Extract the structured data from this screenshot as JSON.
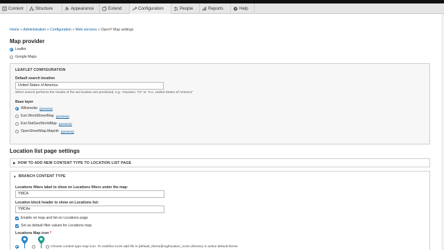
{
  "toolbar": {
    "items": [
      {
        "label": "Content",
        "icon": "content-icon"
      },
      {
        "label": "Structure",
        "icon": "structure-icon"
      },
      {
        "label": "Appearance",
        "icon": "appearance-icon"
      },
      {
        "label": "Extend",
        "icon": "extend-icon"
      },
      {
        "label": "Configuration",
        "icon": "wrench-icon"
      },
      {
        "label": "People",
        "icon": "people-icon"
      },
      {
        "label": "Reports",
        "icon": "reports-icon"
      },
      {
        "label": "Help",
        "icon": "help-icon"
      }
    ]
  },
  "breadcrumb": {
    "home": "Home",
    "administration": "Administration",
    "configuration": "Configuration",
    "web_services": "Web services",
    "current": "OpenY Map settings",
    "separator": "»"
  },
  "map_provider": {
    "title": "Map provider",
    "leaflet": "Leaflet",
    "google": "Google Maps",
    "selected": "Leaflet"
  },
  "leaflet_config": {
    "legend": "LEAFLET CONFIGURATION",
    "search_label": "Default search location",
    "search_value": "United States of America",
    "search_desc_prefix": "When search performs the results of the set location are prioritized, e.g. ",
    "search_desc_ex1": "\"Houston, TX\"",
    "search_desc_or": " or ",
    "search_desc_ex2": "\"CA, United States of America\"",
    "base_layer_label": "Base layer",
    "layers": [
      {
        "label": "Wikimedia",
        "preview": "(preview)"
      },
      {
        "label": "Esri.WorldStreetMap",
        "preview": "(preview)"
      },
      {
        "label": "Esri.NatGeoWorldMap",
        "preview": "(preview)"
      },
      {
        "label": "OpenStreetMap.Mapnik",
        "preview": "(preview)"
      }
    ],
    "selected_layer": "Wikimedia"
  },
  "location_list": {
    "title": "Location list page settings",
    "howto_summary": "HOW TO ADD NEW CONTENT TYPE TO LOCATION LIST PAGE",
    "branch_summary": "BRANCH CONTENT TYPE",
    "filters_label": "Locations filters label to show on Locations filters under the map:",
    "filters_value": "YMCA",
    "block_header_label": "Location block header to show on Locations list:",
    "block_header_value": "YMCAs",
    "enable_label": "Enable on map and list on Locations page",
    "default_filter_label": "Set as default filter values for Locations map",
    "icon_label": "Locations Map icon",
    "required_mark": "*",
    "icon_desc": "Choose content type map icon. To redefine icons add file in [default_theme]/img/location_icons directory in active default theme"
  },
  "colors": {
    "link": "#0a5fa3",
    "accent": "#0a6db3",
    "pin_blue": "#2a86c6",
    "pin_teal": "#1f9c8e"
  }
}
